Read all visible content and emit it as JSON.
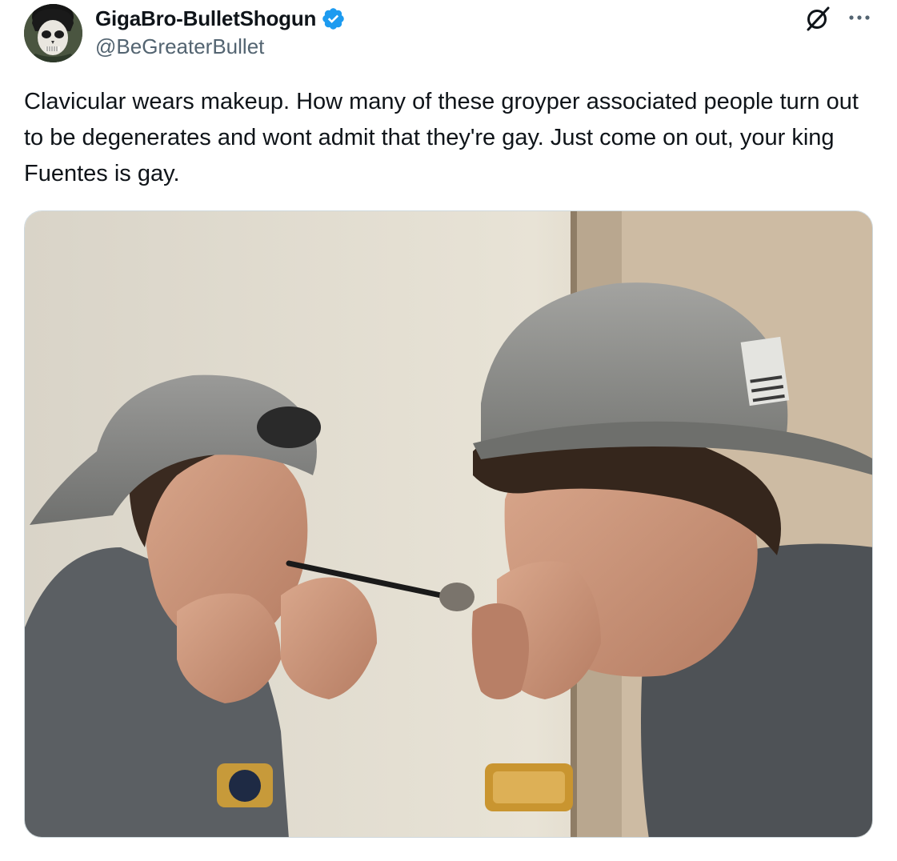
{
  "author": {
    "display_name": "GigaBro-BulletShogun",
    "handle": "@BeGreaterBullet",
    "verified": true,
    "avatar_icon": "skull-mask-avatar"
  },
  "header_actions": {
    "grok_icon": "grok-slash-icon",
    "more_icon": "ellipsis-icon"
  },
  "tweet": {
    "text": "Clavicular wears makeup. How many of these groyper associated people turn out to be degenerates and wont admit that they're gay. Just come on out, your king Fuentes is gay."
  },
  "media": {
    "type": "photo",
    "subject": "man in grey cap applying makeup in front of a mirror"
  },
  "colors": {
    "text_primary": "#0f1419",
    "text_secondary": "#536471",
    "verified_blue": "#1d9bf0",
    "border": "#cfd9de"
  }
}
